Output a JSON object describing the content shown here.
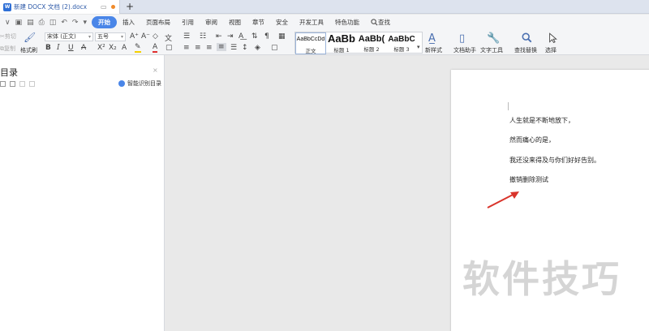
{
  "tab": {
    "icon_text": "W",
    "title": "新建 DOCX 文档 (2).docx",
    "new_tab_label": "+"
  },
  "menu": {
    "items": [
      "插入",
      "页面布局",
      "引用",
      "审阅",
      "视图",
      "章节",
      "安全",
      "开发工具",
      "特色功能"
    ],
    "active": "开始",
    "search_label": "查找"
  },
  "ribbon": {
    "cut": "剪切",
    "copy": "复制",
    "format_painter": "格式刷",
    "font_family": "宋体 (正文)",
    "font_size": "五号",
    "styles": [
      {
        "sample": "AaBbCcDd",
        "name": "正文"
      },
      {
        "sample": "AaBb",
        "name": "标题 1"
      },
      {
        "sample": "AaBb(",
        "name": "标题 2"
      },
      {
        "sample": "AaBbC",
        "name": "标题 3"
      }
    ],
    "new_style": "新样式",
    "doc_helper": "文档助手",
    "text_tools": "文字工具",
    "find_replace": "查找替换",
    "select": "选择"
  },
  "nav": {
    "title": "目录",
    "close": "×",
    "smart_toc": "智能识别目录"
  },
  "document": {
    "lines": [
      "人生就是不断地放下，",
      "然而痛心的是，",
      "我还没来得及与你们好好告别。",
      "撤销删除测试"
    ]
  },
  "watermark": "软件技巧",
  "colors": {
    "accent": "#4a86e8",
    "arrow": "#d9342b",
    "font_color_underline": "#e03030",
    "highlight": "#f5d000"
  }
}
